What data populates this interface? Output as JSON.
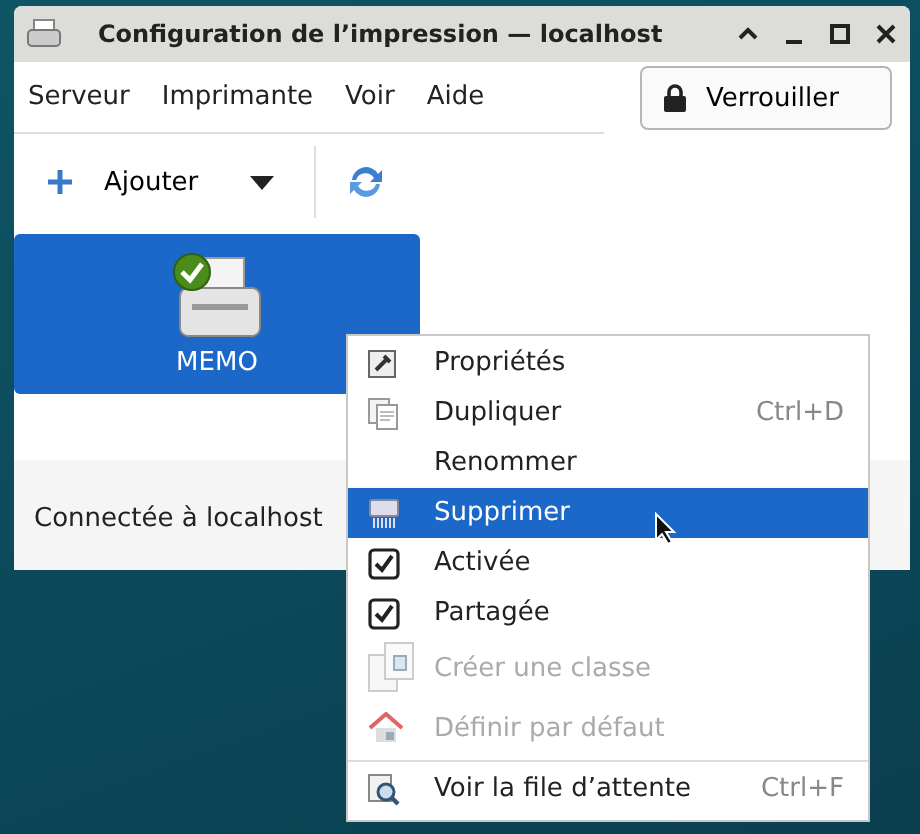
{
  "window": {
    "title": "Configuration de l’impression — localhost"
  },
  "menubar": [
    "Serveur",
    "Imprimante",
    "Voir",
    "Aide"
  ],
  "lock_button": {
    "label": "Verrouiller"
  },
  "toolbar": {
    "add_button": {
      "label": "Ajouter"
    }
  },
  "printers": [
    {
      "name": "MEMO",
      "selected": true
    }
  ],
  "status_bar": "Connectée à localhost",
  "context_menu": [
    {
      "kind": "icon",
      "label": "Propriétés",
      "selected": false,
      "disabled": false
    },
    {
      "kind": "icon",
      "label": "Dupliquer",
      "shortcut": "Ctrl+D",
      "selected": false,
      "disabled": false
    },
    {
      "kind": "plain",
      "label": "Renommer",
      "selected": false,
      "disabled": false
    },
    {
      "kind": "icon",
      "label": "Supprimer",
      "selected": true,
      "disabled": false
    },
    {
      "kind": "check",
      "label": "Activée",
      "checked": true,
      "selected": false,
      "disabled": false
    },
    {
      "kind": "check",
      "label": "Partagée",
      "checked": true,
      "selected": false,
      "disabled": false
    },
    {
      "kind": "icon",
      "label": "Créer une classe",
      "selected": false,
      "disabled": true
    },
    {
      "kind": "icon",
      "label": "Définir par défaut",
      "selected": false,
      "disabled": true
    },
    {
      "kind": "separator"
    },
    {
      "kind": "icon",
      "label": "Voir la file d’attente",
      "shortcut": "Ctrl+F",
      "selected": false,
      "disabled": false
    }
  ]
}
